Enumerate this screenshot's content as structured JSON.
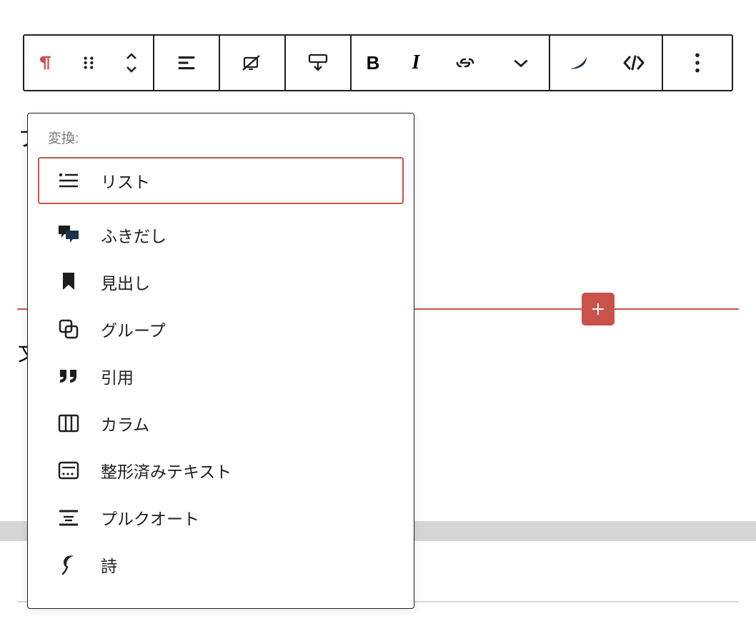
{
  "toolbar": {
    "paragraph_icon": "paragraph",
    "drag_icon": "drag",
    "move_icon": "move-arrows",
    "align_icon": "align-left",
    "edit_visually_icon": "edit-visually",
    "full_width_icon": "full-width",
    "bold_label": "B",
    "italic_label": "I",
    "link_icon": "link",
    "more_rich_icon": "chevron-down",
    "theme_icon": "theme",
    "code_icon": "code",
    "more_icon": "more-vertical"
  },
  "popover": {
    "title": "変換:",
    "items": [
      {
        "icon": "list",
        "label": "リスト",
        "highlight": true
      },
      {
        "icon": "speech",
        "label": "ふきだし",
        "highlight": false
      },
      {
        "icon": "bookmark",
        "label": "見出し",
        "highlight": false
      },
      {
        "icon": "group",
        "label": "グループ",
        "highlight": false
      },
      {
        "icon": "quote",
        "label": "引用",
        "highlight": false
      },
      {
        "icon": "columns",
        "label": "カラム",
        "highlight": false
      },
      {
        "icon": "preformatted",
        "label": "整形済みテキスト",
        "highlight": false
      },
      {
        "icon": "pullquote",
        "label": "プルクオート",
        "highlight": false
      },
      {
        "icon": "verse",
        "label": "詩",
        "highlight": false
      }
    ]
  },
  "background": {
    "fragment1": "フ",
    "fragment2": "文"
  }
}
